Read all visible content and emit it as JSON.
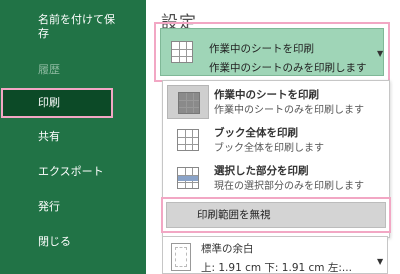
{
  "sidebar": {
    "items": [
      {
        "id": "save-as",
        "line1": "名前を付けて保",
        "line2": "存"
      },
      {
        "id": "history",
        "label": "履歴",
        "disabled": true
      },
      {
        "id": "print",
        "label": "印刷",
        "selected": true
      },
      {
        "id": "share",
        "label": "共有"
      },
      {
        "id": "export",
        "label": "エクスポート"
      },
      {
        "id": "publish",
        "label": "発行"
      },
      {
        "id": "close",
        "label": "閉じる"
      }
    ],
    "background": "#217346",
    "selected_background": "#0c4a27"
  },
  "main": {
    "section_title": "設定",
    "print_what_dropdown": {
      "title": "作業中のシートを印刷",
      "subtitle": "作業中のシートのみを印刷します",
      "icon": "sheet-grid-icon",
      "caret": "▼"
    },
    "menu": {
      "items": [
        {
          "title": "作業中のシートを印刷",
          "subtitle": "作業中のシートのみを印刷します",
          "icon": "sheet-grid-icon",
          "active": true
        },
        {
          "title": "ブック全体を印刷",
          "subtitle": "ブック全体を印刷します",
          "icon": "sheet-grid-icon"
        },
        {
          "title": "選択した部分を印刷",
          "subtitle": "現在の選択部分のみを印刷します",
          "icon": "selection-grid-icon"
        }
      ],
      "ignore_print_area_label": "印刷範囲を無視"
    },
    "margins_dropdown": {
      "title": "標準の余白",
      "subtitle": "上: 1.91 cm 下: 1.91 cm 左:...",
      "icon": "page-margins-icon",
      "caret": "▼"
    }
  },
  "colors": {
    "highlight_border": "#f2a7c4",
    "dropdown_fill": "#9fd5b7"
  }
}
